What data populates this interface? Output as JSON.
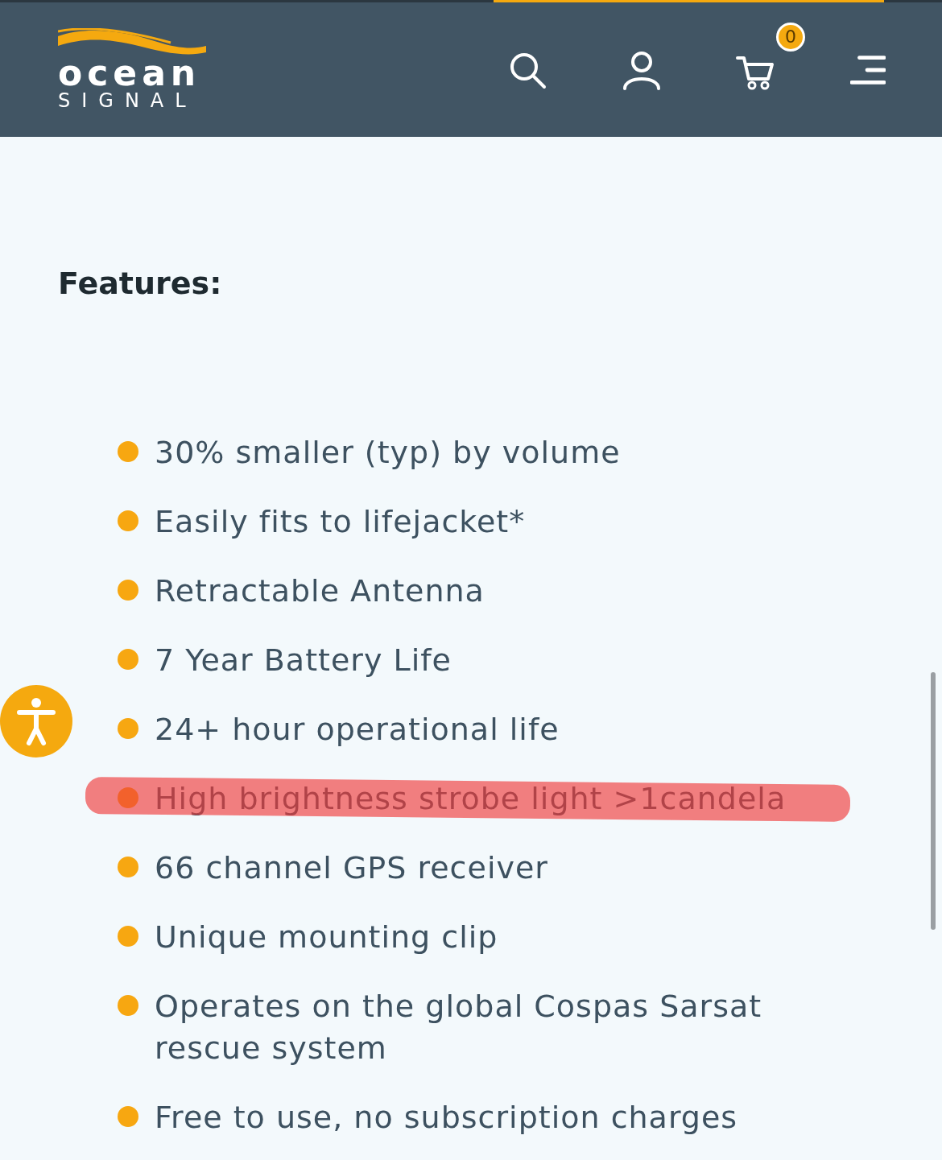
{
  "header": {
    "logo": {
      "word": "ocean",
      "subword": "SIGNAL"
    },
    "cart_count": "0"
  },
  "features": {
    "heading": "Features:",
    "items": [
      {
        "text": "30% smaller (typ) by volume",
        "highlighted": false
      },
      {
        "text": "Easily fits to lifejacket*",
        "highlighted": false
      },
      {
        "text": "Retractable Antenna",
        "highlighted": false
      },
      {
        "text": "7 Year Battery Life",
        "highlighted": false
      },
      {
        "text": "24+ hour operational life",
        "highlighted": false
      },
      {
        "text": "High brightness strobe light >1candela",
        "highlighted": true
      },
      {
        "text": "66 channel GPS receiver",
        "highlighted": false
      },
      {
        "text": "Unique mounting clip",
        "highlighted": false
      },
      {
        "text": "Operates on the global Cospas Sarsat rescue system",
        "highlighted": false
      },
      {
        "text": "Free to use, no subscription charges",
        "highlighted": false
      }
    ]
  }
}
